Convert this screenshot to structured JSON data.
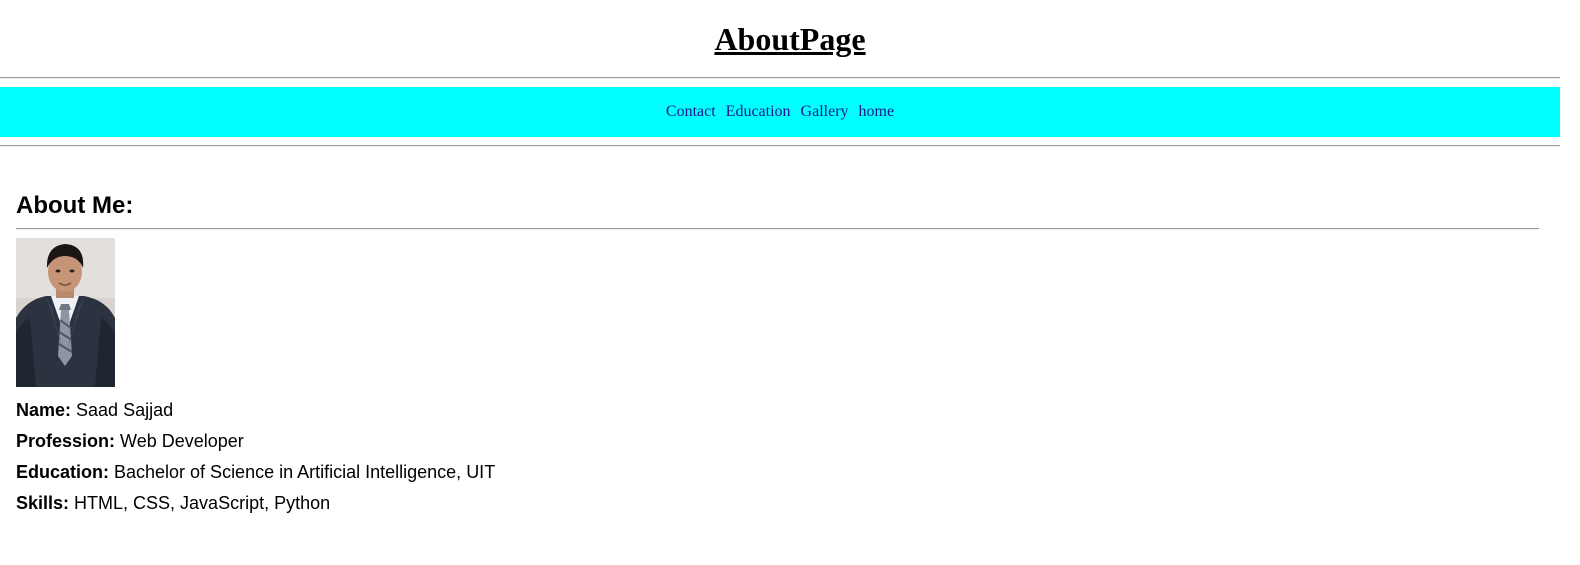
{
  "header": {
    "title": "AboutPage"
  },
  "nav": {
    "background_color": "#00ffff",
    "link_color": "#1a1a8c",
    "links": [
      {
        "label": "Contact"
      },
      {
        "label": "Education"
      },
      {
        "label": "Gallery"
      },
      {
        "label": "home"
      }
    ]
  },
  "about": {
    "heading": "About Me:",
    "photo_icon": "profile-photo-icon",
    "details": [
      {
        "key": "Name:",
        "value": " Saad Sajjad"
      },
      {
        "key": "Profession:",
        "value": " Web Developer"
      },
      {
        "key": "Education:",
        "value": " Bachelor of Science in Artificial Intelligence, UIT"
      },
      {
        "key": "Skills:",
        "value": " HTML, CSS, JavaScript, Python"
      }
    ]
  }
}
